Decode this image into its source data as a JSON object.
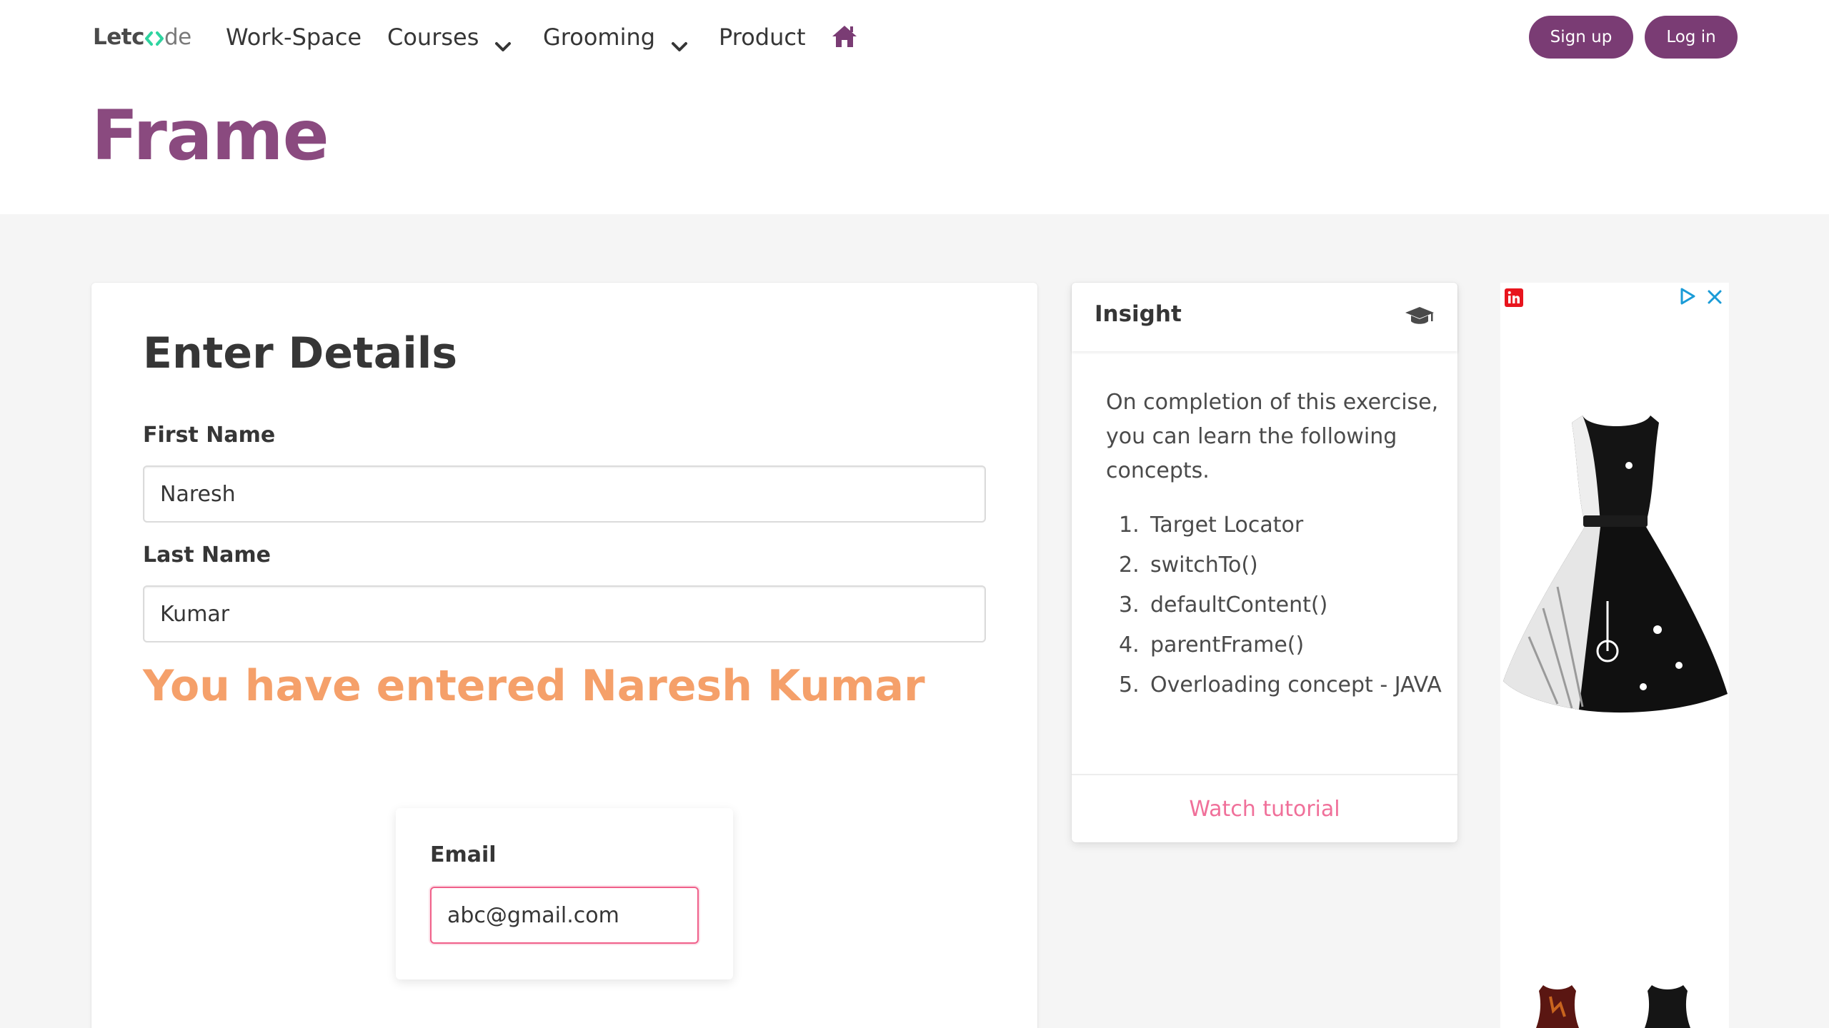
{
  "brand": {
    "prefix": "Letc",
    "suffix": "de"
  },
  "nav": {
    "items": [
      {
        "label": "Work-Space"
      },
      {
        "label": "Courses"
      },
      {
        "label": "Grooming"
      },
      {
        "label": "Product"
      }
    ],
    "signup_label": "Sign up",
    "login_label": "Log in"
  },
  "page": {
    "title": "Frame"
  },
  "form": {
    "heading": "Enter Details",
    "first_name_label": "First Name",
    "first_name_value": "Naresh",
    "last_name_label": "Last Name",
    "last_name_value": "Kumar",
    "result_text": "You have entered Naresh Kumar",
    "email_label": "Email",
    "email_value": "abc@gmail.com"
  },
  "insight": {
    "title": "Insight",
    "intro": "On completion of this exercise, you can learn the following concepts.",
    "concepts": [
      {
        "num": "1.",
        "text": "Target Locator"
      },
      {
        "num": "2.",
        "text": "switchTo()"
      },
      {
        "num": "3.",
        "text": "defaultContent()"
      },
      {
        "num": "4.",
        "text": "parentFrame()"
      },
      {
        "num": "5.",
        "text": "Overloading concept - JAVA"
      }
    ],
    "watch_label": "Watch tutorial"
  },
  "colors": {
    "brand_purple": "#7a3c74",
    "title_purple": "#8a4a7f",
    "result_orange": "#f5a06a",
    "link_pink": "#f0709a",
    "focus_pink": "#f0608a",
    "logo_green": "#2fd4a0"
  },
  "icons": {
    "home": "home-icon",
    "courses_chevron": "chevron-down-icon",
    "grooming_chevron": "chevron-down-icon",
    "insight": "graduation-cap-icon",
    "ad_close": "close-icon",
    "ad_choices": "ad-choices-icon"
  }
}
